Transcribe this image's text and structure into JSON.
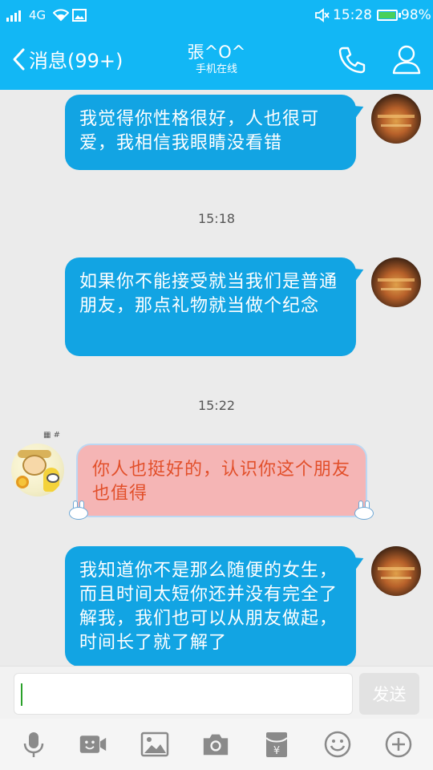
{
  "status_bar": {
    "network": "4G",
    "time": "15:28",
    "battery": "98%"
  },
  "header": {
    "back_label": "消息(99+)",
    "contact_name": "張^O^",
    "contact_status": "手机在线"
  },
  "messages": [
    {
      "from": "me",
      "text": "我觉得你性格很好，人也很可爱，我相信我眼睛没看错"
    },
    {
      "timestamp": "15:18"
    },
    {
      "from": "me",
      "text": "如果你不能接受就当我们是普通朋友，那点礼物就当做个纪念"
    },
    {
      "timestamp": "15:22"
    },
    {
      "from": "contact",
      "text": "你人也挺好的，认识你这个朋友也值得"
    },
    {
      "from": "me",
      "text": "我知道你不是那么随便的女生，而且时间太短你还并没有完全了解我，我们也可以从朋友做起，时间长了就了解了"
    }
  ],
  "input": {
    "value": "",
    "send_label": "发送"
  },
  "toolbar": {
    "items": [
      "microphone-icon",
      "video-chat-icon",
      "image-icon",
      "camera-icon",
      "red-packet-icon",
      "emoji-icon",
      "more-plus-icon"
    ]
  },
  "colors": {
    "header_bg": "#12b7f5",
    "outgoing_bubble": "#12a4e3",
    "incoming_bubble": "#f5b5b5",
    "incoming_text": "#e24f2a",
    "toolbar_icon": "#8a8a8a"
  }
}
